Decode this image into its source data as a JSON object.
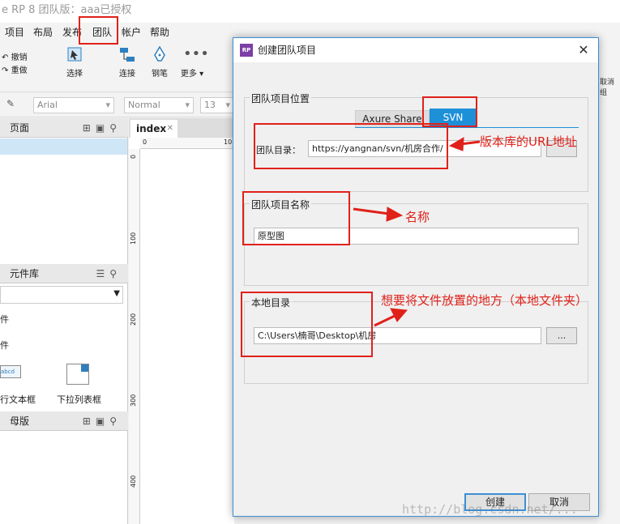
{
  "window": {
    "title": "e RP 8 团队版：aaa已授权"
  },
  "menu": {
    "items": [
      "项目",
      "布局",
      "发布",
      "团队",
      "帐户",
      "帮助"
    ]
  },
  "toolbar": {
    "undo": "撤销",
    "redo": "重做",
    "select": "选择",
    "connect": "连接",
    "pen": "钢笔",
    "more": "更多 ▾",
    "right_cut": "取消组"
  },
  "format": {
    "font": "Arial",
    "style": "Normal",
    "size": "13"
  },
  "left_panel": {
    "pages_title": "页面",
    "library_title": "元件库",
    "library_items": [
      "件",
      "件"
    ],
    "widgets": [
      "行文本框",
      "下拉列表框"
    ],
    "masters_title": "母版"
  },
  "canvas": {
    "tab": "index",
    "ruler_h": [
      "0",
      "10"
    ],
    "ruler_v": [
      "0",
      "100",
      "200",
      "300",
      "400"
    ]
  },
  "dialog": {
    "logo": "RP",
    "title": "创建团队项目",
    "location_group": "团队项目位置",
    "tab_axure": "Axure Share",
    "tab_svn": "SVN",
    "dir_label": "团队目录：",
    "dir_value": "https://yangnan/svn/机房合作/",
    "name_group": "团队项目名称",
    "name_value": "原型图",
    "local_group": "本地目录",
    "local_value": "C:\\Users\\楠哥\\Desktop\\机房",
    "browse": "...",
    "create": "创建",
    "cancel": "取消"
  },
  "annotations": {
    "url": "版本库的URL地址",
    "name": "名称",
    "local": "想要将文件放置的地方（本地文件夹）"
  },
  "watermark": "http://blog.csdn.net/..."
}
